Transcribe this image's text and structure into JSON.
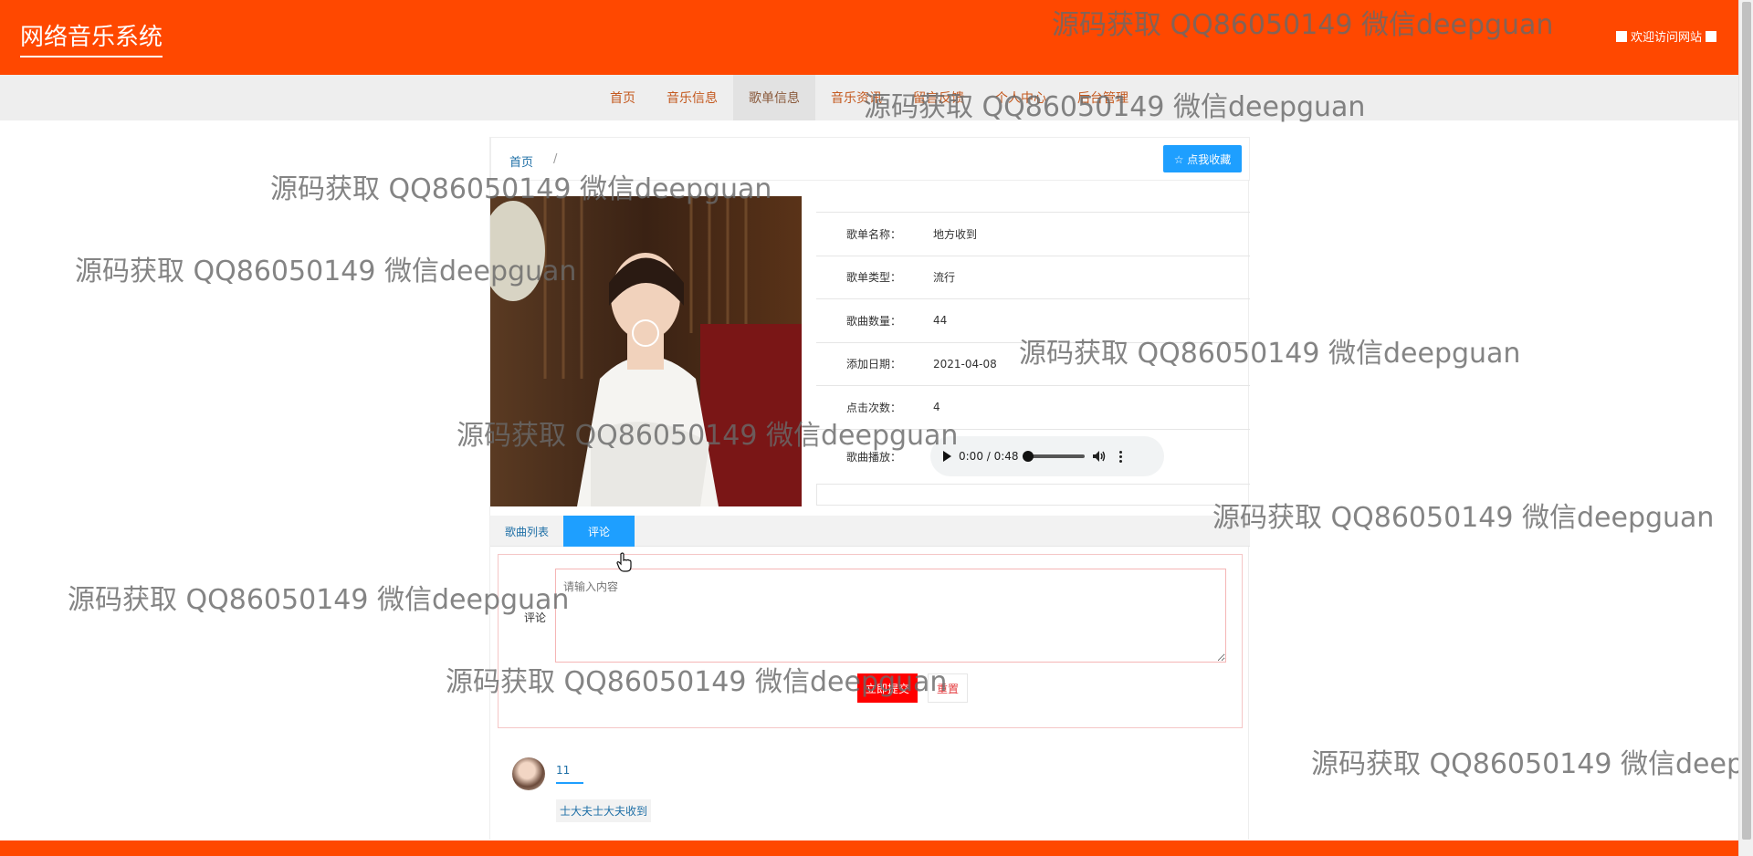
{
  "header": {
    "brand": "网络音乐系统",
    "welcome": "欢迎访问网站"
  },
  "nav": {
    "items": [
      "首页",
      "音乐信息",
      "歌单信息",
      "音乐资讯",
      "留言反馈",
      "个人中心",
      "后台管理"
    ],
    "active": "歌单信息"
  },
  "breadcrumb": {
    "home": "首页",
    "sep": "/"
  },
  "favorite_button": "☆ 点我收藏",
  "playlist": {
    "fields": [
      {
        "label": "歌单名称：",
        "value": "地方收到"
      },
      {
        "label": "歌单类型：",
        "value": "流行"
      },
      {
        "label": "歌曲数量：",
        "value": "44"
      },
      {
        "label": "添加日期：",
        "value": "2021-04-08"
      },
      {
        "label": "点击次数：",
        "value": "4"
      }
    ],
    "player_label": "歌曲播放：",
    "player_time": "0:00 / 0:48"
  },
  "tabs": [
    "歌曲列表",
    "评论"
  ],
  "comment_form": {
    "label": "评论",
    "placeholder": "请输入内容",
    "submit": "立即提交",
    "reset": "重置"
  },
  "comments": [
    {
      "user": "11",
      "text": "士大夫士大夫收到"
    }
  ],
  "watermark": "源码获取 QQ86050149 微信deepguan",
  "colors": {
    "header_bg": "#ff4800",
    "nav_bg": "#eeeeee",
    "accent": "#1e9fff",
    "submit": "#ff0000"
  }
}
